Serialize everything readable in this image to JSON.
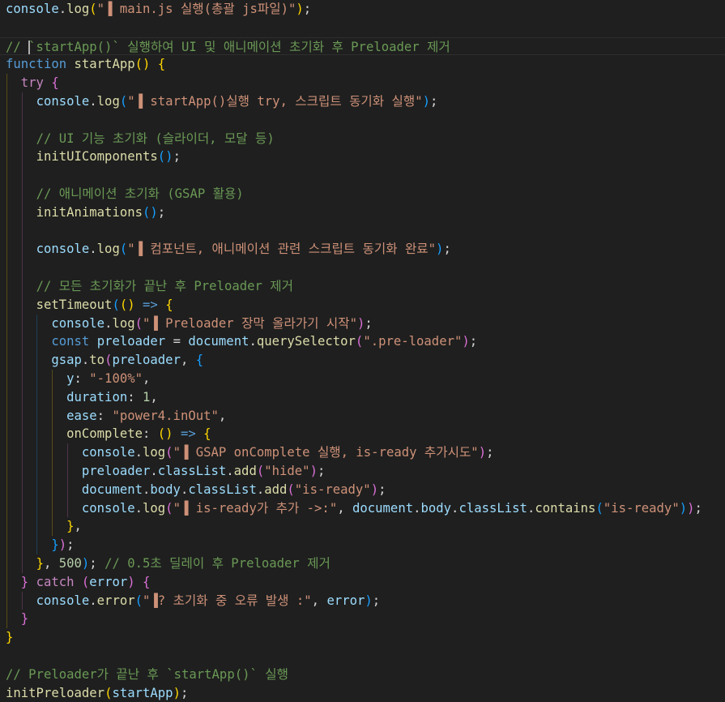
{
  "editor": {
    "lines": [
      [
        {
          "t": "console",
          "c": "var"
        },
        {
          "t": ".",
          "c": "plain"
        },
        {
          "t": "log",
          "c": "fn"
        },
        {
          "t": "(",
          "c": "b1"
        },
        {
          "t": "\"▐ main.js 실행(총괄 js파일)\"",
          "c": "str"
        },
        {
          "t": ")",
          "c": "b1"
        },
        {
          "t": ";",
          "c": "plain"
        }
      ],
      [],
      [
        {
          "t": "// ",
          "c": "cmt"
        },
        {
          "t": "`startApp()` 실행하여 UI 및 애니메이션 초기화 후 Preloader 제거",
          "c": "cmt"
        }
      ],
      [
        {
          "t": "function",
          "c": "kw"
        },
        {
          "t": " ",
          "c": "plain"
        },
        {
          "t": "startApp",
          "c": "fn"
        },
        {
          "t": "()",
          "c": "b1"
        },
        {
          "t": " ",
          "c": "plain"
        },
        {
          "t": "{",
          "c": "b1"
        }
      ],
      [
        {
          "t": "  ",
          "c": "plain"
        },
        {
          "t": "try",
          "c": "ctl"
        },
        {
          "t": " ",
          "c": "plain"
        },
        {
          "t": "{",
          "c": "b2"
        }
      ],
      [
        {
          "t": "    ",
          "c": "plain"
        },
        {
          "t": "console",
          "c": "var"
        },
        {
          "t": ".",
          "c": "plain"
        },
        {
          "t": "log",
          "c": "fn"
        },
        {
          "t": "(",
          "c": "b3"
        },
        {
          "t": "\"▐ startApp()실행 try, 스크립트 동기화 실행\"",
          "c": "str"
        },
        {
          "t": ")",
          "c": "b3"
        },
        {
          "t": ";",
          "c": "plain"
        }
      ],
      [],
      [
        {
          "t": "    ",
          "c": "plain"
        },
        {
          "t": "// UI 기능 초기화 (슬라이더, 모달 등)",
          "c": "cmt"
        }
      ],
      [
        {
          "t": "    ",
          "c": "plain"
        },
        {
          "t": "initUIComponents",
          "c": "fn"
        },
        {
          "t": "()",
          "c": "b3"
        },
        {
          "t": ";",
          "c": "plain"
        }
      ],
      [],
      [
        {
          "t": "    ",
          "c": "plain"
        },
        {
          "t": "// 애니메이션 초기화 (GSAP 활용)",
          "c": "cmt"
        }
      ],
      [
        {
          "t": "    ",
          "c": "plain"
        },
        {
          "t": "initAnimations",
          "c": "fn"
        },
        {
          "t": "()",
          "c": "b3"
        },
        {
          "t": ";",
          "c": "plain"
        }
      ],
      [],
      [
        {
          "t": "    ",
          "c": "plain"
        },
        {
          "t": "console",
          "c": "var"
        },
        {
          "t": ".",
          "c": "plain"
        },
        {
          "t": "log",
          "c": "fn"
        },
        {
          "t": "(",
          "c": "b3"
        },
        {
          "t": "\"▐ 컴포넌트, 애니메이션 관련 스크립트 동기화 완료\"",
          "c": "str"
        },
        {
          "t": ")",
          "c": "b3"
        },
        {
          "t": ";",
          "c": "plain"
        }
      ],
      [],
      [
        {
          "t": "    ",
          "c": "plain"
        },
        {
          "t": "// 모든 초기화가 끝난 후 Preloader 제거",
          "c": "cmt"
        }
      ],
      [
        {
          "t": "    ",
          "c": "plain"
        },
        {
          "t": "setTimeout",
          "c": "fn"
        },
        {
          "t": "(",
          "c": "b3"
        },
        {
          "t": "()",
          "c": "b1"
        },
        {
          "t": " ",
          "c": "plain"
        },
        {
          "t": "=>",
          "c": "kw"
        },
        {
          "t": " ",
          "c": "plain"
        },
        {
          "t": "{",
          "c": "b1"
        }
      ],
      [
        {
          "t": "      ",
          "c": "plain"
        },
        {
          "t": "console",
          "c": "var"
        },
        {
          "t": ".",
          "c": "plain"
        },
        {
          "t": "log",
          "c": "fn"
        },
        {
          "t": "(",
          "c": "b2"
        },
        {
          "t": "\"▐ Preloader 장막 올라가기 시작\"",
          "c": "str"
        },
        {
          "t": ")",
          "c": "b2"
        },
        {
          "t": ";",
          "c": "plain"
        }
      ],
      [
        {
          "t": "      ",
          "c": "plain"
        },
        {
          "t": "const",
          "c": "kw"
        },
        {
          "t": " ",
          "c": "plain"
        },
        {
          "t": "preloader",
          "c": "var"
        },
        {
          "t": " = ",
          "c": "plain"
        },
        {
          "t": "document",
          "c": "var"
        },
        {
          "t": ".",
          "c": "plain"
        },
        {
          "t": "querySelector",
          "c": "fn"
        },
        {
          "t": "(",
          "c": "b2"
        },
        {
          "t": "\".pre-loader\"",
          "c": "str"
        },
        {
          "t": ")",
          "c": "b2"
        },
        {
          "t": ";",
          "c": "plain"
        }
      ],
      [
        {
          "t": "      ",
          "c": "plain"
        },
        {
          "t": "gsap",
          "c": "var"
        },
        {
          "t": ".",
          "c": "plain"
        },
        {
          "t": "to",
          "c": "fn"
        },
        {
          "t": "(",
          "c": "b2"
        },
        {
          "t": "preloader",
          "c": "var"
        },
        {
          "t": ", ",
          "c": "plain"
        },
        {
          "t": "{",
          "c": "b3"
        }
      ],
      [
        {
          "t": "        ",
          "c": "plain"
        },
        {
          "t": "y",
          "c": "var"
        },
        {
          "t": ": ",
          "c": "plain"
        },
        {
          "t": "\"-100%\"",
          "c": "str"
        },
        {
          "t": ",",
          "c": "plain"
        }
      ],
      [
        {
          "t": "        ",
          "c": "plain"
        },
        {
          "t": "duration",
          "c": "var"
        },
        {
          "t": ": ",
          "c": "plain"
        },
        {
          "t": "1",
          "c": "num"
        },
        {
          "t": ",",
          "c": "plain"
        }
      ],
      [
        {
          "t": "        ",
          "c": "plain"
        },
        {
          "t": "ease",
          "c": "var"
        },
        {
          "t": ": ",
          "c": "plain"
        },
        {
          "t": "\"power4.inOut\"",
          "c": "str"
        },
        {
          "t": ",",
          "c": "plain"
        }
      ],
      [
        {
          "t": "        ",
          "c": "plain"
        },
        {
          "t": "onComplete",
          "c": "fn"
        },
        {
          "t": ": ",
          "c": "plain"
        },
        {
          "t": "()",
          "c": "b1"
        },
        {
          "t": " ",
          "c": "plain"
        },
        {
          "t": "=>",
          "c": "kw"
        },
        {
          "t": " ",
          "c": "plain"
        },
        {
          "t": "{",
          "c": "b1"
        }
      ],
      [
        {
          "t": "          ",
          "c": "plain"
        },
        {
          "t": "console",
          "c": "var"
        },
        {
          "t": ".",
          "c": "plain"
        },
        {
          "t": "log",
          "c": "fn"
        },
        {
          "t": "(",
          "c": "b2"
        },
        {
          "t": "\"▐ GSAP onComplete 실행, is-ready 추가시도\"",
          "c": "str"
        },
        {
          "t": ")",
          "c": "b2"
        },
        {
          "t": ";",
          "c": "plain"
        }
      ],
      [
        {
          "t": "          ",
          "c": "plain"
        },
        {
          "t": "preloader",
          "c": "var"
        },
        {
          "t": ".",
          "c": "plain"
        },
        {
          "t": "classList",
          "c": "var"
        },
        {
          "t": ".",
          "c": "plain"
        },
        {
          "t": "add",
          "c": "fn"
        },
        {
          "t": "(",
          "c": "b2"
        },
        {
          "t": "\"hide\"",
          "c": "str"
        },
        {
          "t": ")",
          "c": "b2"
        },
        {
          "t": ";",
          "c": "plain"
        }
      ],
      [
        {
          "t": "          ",
          "c": "plain"
        },
        {
          "t": "document",
          "c": "var"
        },
        {
          "t": ".",
          "c": "plain"
        },
        {
          "t": "body",
          "c": "var"
        },
        {
          "t": ".",
          "c": "plain"
        },
        {
          "t": "classList",
          "c": "var"
        },
        {
          "t": ".",
          "c": "plain"
        },
        {
          "t": "add",
          "c": "fn"
        },
        {
          "t": "(",
          "c": "b2"
        },
        {
          "t": "\"is-ready\"",
          "c": "str"
        },
        {
          "t": ")",
          "c": "b2"
        },
        {
          "t": ";",
          "c": "plain"
        }
      ],
      [
        {
          "t": "          ",
          "c": "plain"
        },
        {
          "t": "console",
          "c": "var"
        },
        {
          "t": ".",
          "c": "plain"
        },
        {
          "t": "log",
          "c": "fn"
        },
        {
          "t": "(",
          "c": "b2"
        },
        {
          "t": "\"▐ is-ready가 추가 ->:\"",
          "c": "str"
        },
        {
          "t": ", ",
          "c": "plain"
        },
        {
          "t": "document",
          "c": "var"
        },
        {
          "t": ".",
          "c": "plain"
        },
        {
          "t": "body",
          "c": "var"
        },
        {
          "t": ".",
          "c": "plain"
        },
        {
          "t": "classList",
          "c": "var"
        },
        {
          "t": ".",
          "c": "plain"
        },
        {
          "t": "contains",
          "c": "fn"
        },
        {
          "t": "(",
          "c": "b3"
        },
        {
          "t": "\"is-ready\"",
          "c": "str"
        },
        {
          "t": ")",
          "c": "b3"
        },
        {
          "t": ")",
          "c": "b2"
        },
        {
          "t": ";",
          "c": "plain"
        }
      ],
      [
        {
          "t": "        ",
          "c": "plain"
        },
        {
          "t": "}",
          "c": "b1"
        },
        {
          "t": ",",
          "c": "plain"
        }
      ],
      [
        {
          "t": "      ",
          "c": "plain"
        },
        {
          "t": "}",
          "c": "b3"
        },
        {
          "t": ")",
          "c": "b2"
        },
        {
          "t": ";",
          "c": "plain"
        }
      ],
      [
        {
          "t": "    ",
          "c": "plain"
        },
        {
          "t": "}",
          "c": "b1"
        },
        {
          "t": ", ",
          "c": "plain"
        },
        {
          "t": "500",
          "c": "num"
        },
        {
          "t": ")",
          "c": "b3"
        },
        {
          "t": "; ",
          "c": "plain"
        },
        {
          "t": "// 0.5초 딜레이 후 Preloader 제거",
          "c": "cmt"
        }
      ],
      [
        {
          "t": "  ",
          "c": "plain"
        },
        {
          "t": "}",
          "c": "b2"
        },
        {
          "t": " ",
          "c": "plain"
        },
        {
          "t": "catch",
          "c": "ctl"
        },
        {
          "t": " ",
          "c": "plain"
        },
        {
          "t": "(",
          "c": "b2"
        },
        {
          "t": "error",
          "c": "var"
        },
        {
          "t": ")",
          "c": "b2"
        },
        {
          "t": " ",
          "c": "plain"
        },
        {
          "t": "{",
          "c": "b2"
        }
      ],
      [
        {
          "t": "    ",
          "c": "plain"
        },
        {
          "t": "console",
          "c": "var"
        },
        {
          "t": ".",
          "c": "plain"
        },
        {
          "t": "error",
          "c": "fn"
        },
        {
          "t": "(",
          "c": "b3"
        },
        {
          "t": "\"▐? 초기화 중 오류 발생 :\"",
          "c": "str"
        },
        {
          "t": ", ",
          "c": "plain"
        },
        {
          "t": "error",
          "c": "var"
        },
        {
          "t": ")",
          "c": "b3"
        },
        {
          "t": ";",
          "c": "plain"
        }
      ],
      [
        {
          "t": "  ",
          "c": "plain"
        },
        {
          "t": "}",
          "c": "b2"
        }
      ],
      [
        {
          "t": "}",
          "c": "b1"
        }
      ],
      [],
      [
        {
          "t": "// Preloader가 끝난 후 `startApp()` 실행",
          "c": "cmt"
        }
      ],
      [
        {
          "t": "initPreloader",
          "c": "fn"
        },
        {
          "t": "(",
          "c": "b1"
        },
        {
          "t": "startApp",
          "c": "var"
        },
        {
          "t": ")",
          "c": "b1"
        },
        {
          "t": ";",
          "c": "plain"
        }
      ]
    ]
  },
  "colors": {
    "background": "#1f1f1f",
    "variable": "#9cdcfe",
    "function": "#dcdcaa",
    "string": "#ce9178",
    "comment": "#6a9955",
    "keyword": "#569cd6",
    "control": "#c586c0",
    "number": "#b5cea8",
    "bracket_level_1": "#ffd700",
    "bracket_level_2": "#da70d6",
    "bracket_level_3": "#179fff"
  }
}
